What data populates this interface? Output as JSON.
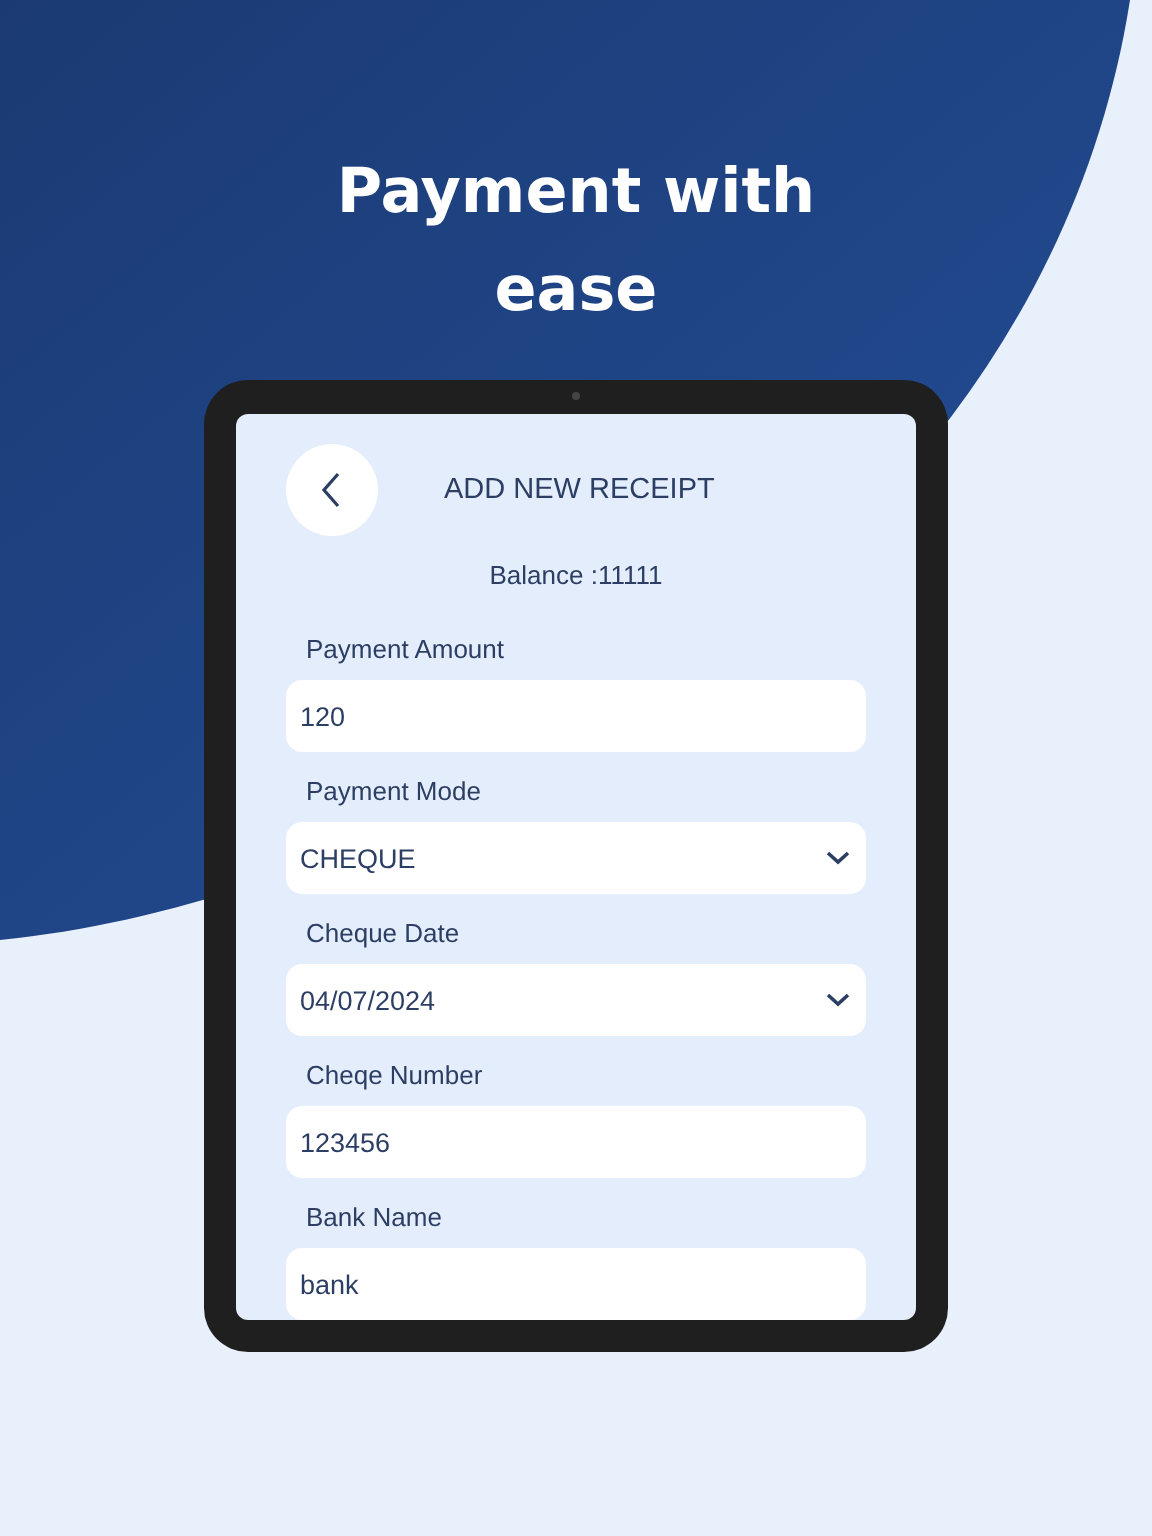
{
  "headline": [
    "Payment with",
    "ease"
  ],
  "screen": {
    "title": "ADD NEW RECEIPT",
    "balance": "Balance :11111",
    "fields": [
      {
        "label": "Payment Amount",
        "value": "120",
        "kind": "text"
      },
      {
        "label": "Payment Mode",
        "value": "CHEQUE",
        "kind": "dropdown"
      },
      {
        "label": "Cheque Date",
        "value": "04/07/2024",
        "kind": "dropdown"
      },
      {
        "label": "Cheqe Number",
        "value": "123456",
        "kind": "text"
      },
      {
        "label": "Bank Name",
        "value": "bank",
        "kind": "text"
      }
    ]
  }
}
